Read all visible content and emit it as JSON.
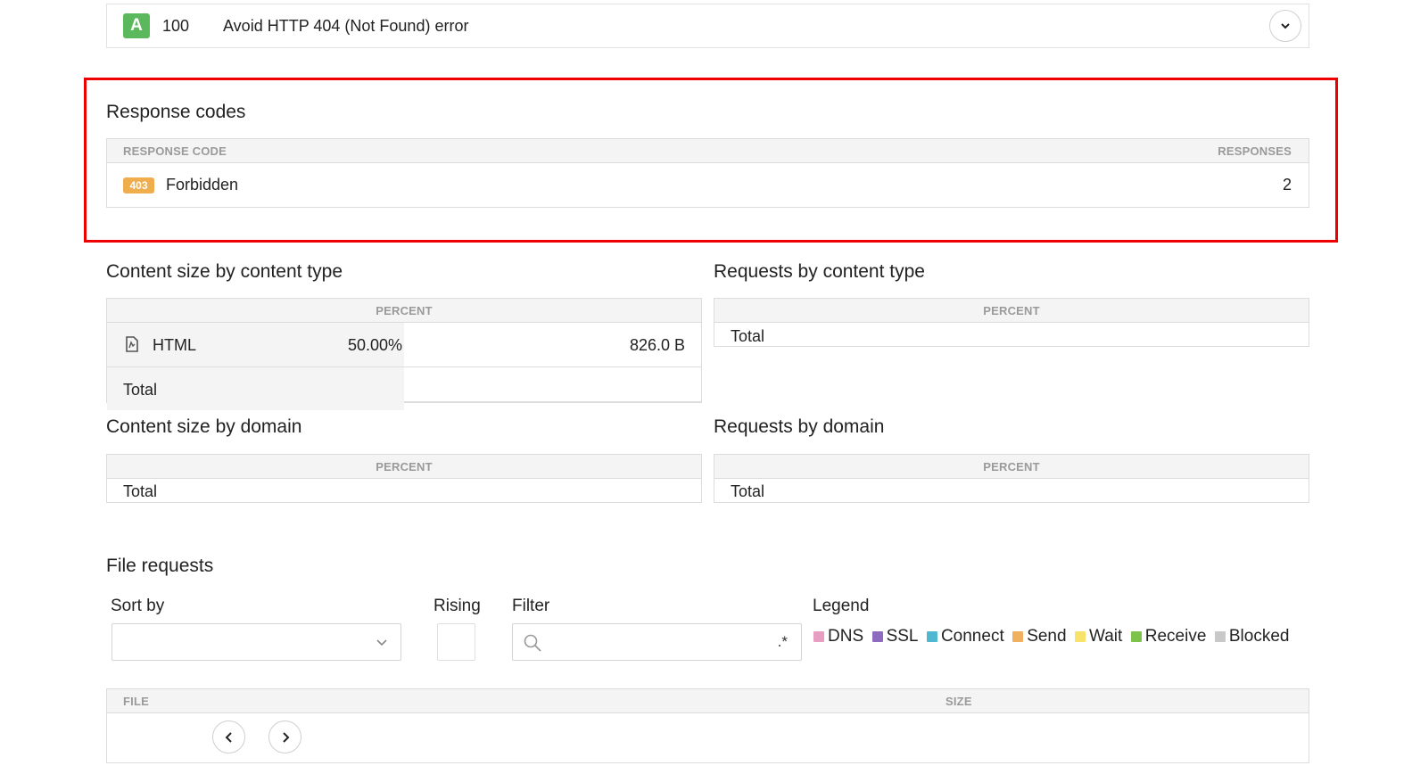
{
  "audit": {
    "grade": "A",
    "score": "100",
    "title": "Avoid HTTP 404 (Not Found) error"
  },
  "response_codes": {
    "title": "Response codes",
    "col_code": "RESPONSE CODE",
    "col_responses": "RESPONSES",
    "rows": [
      {
        "code": "403",
        "label": "Forbidden",
        "count": "2"
      }
    ]
  },
  "content_size_by_type": {
    "title": "Content size by content type",
    "col_percent": "PERCENT",
    "rows": [
      {
        "type": "HTML",
        "percent": "50.00%",
        "size": "826.0 B"
      }
    ],
    "total_label": "Total"
  },
  "requests_by_type": {
    "title": "Requests by content type",
    "col_percent": "PERCENT",
    "total_label": "Total"
  },
  "content_size_by_domain": {
    "title": "Content size by domain",
    "col_percent": "PERCENT",
    "total_label": "Total"
  },
  "requests_by_domain": {
    "title": "Requests by domain",
    "col_percent": "PERCENT",
    "total_label": "Total"
  },
  "file_requests": {
    "title": "File requests",
    "sort_by_label": "Sort by",
    "sort_by_value": "",
    "rising_label": "Rising",
    "filter_label": "Filter",
    "filter_placeholder": "",
    "regex_symbol": ".*",
    "legend_label": "Legend",
    "legend": [
      {
        "name": "DNS",
        "color": "#e89ec0"
      },
      {
        "name": "SSL",
        "color": "#8e6bbf"
      },
      {
        "name": "Connect",
        "color": "#4fb8d0"
      },
      {
        "name": "Send",
        "color": "#f0b060"
      },
      {
        "name": "Wait",
        "color": "#f7e36b"
      },
      {
        "name": "Receive",
        "color": "#7dc24b"
      },
      {
        "name": "Blocked",
        "color": "#c8c8c8"
      }
    ],
    "col_file": "FILE",
    "col_size": "SIZE"
  },
  "colors": {
    "grade_green": "#5cb85c",
    "badge_orange": "#f0ad4e",
    "highlight_red": "#ee0000"
  }
}
